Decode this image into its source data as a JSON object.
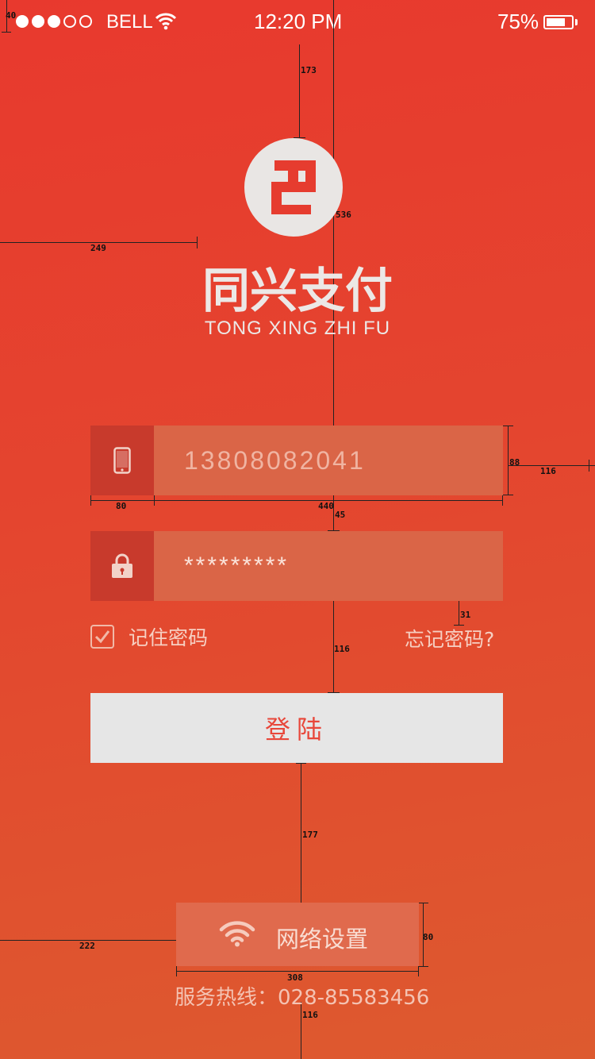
{
  "status_bar": {
    "signal_dots_filled": 3,
    "signal_dots_total": 5,
    "carrier": "BELL",
    "time": "12:20 PM",
    "battery_percent": "75%",
    "battery_level": 0.75
  },
  "brand": {
    "name_cn": "同兴支付",
    "name_en": "TONG XING ZHI FU"
  },
  "login_form": {
    "phone_value": "13808082041",
    "password_value": "*********",
    "remember_label": "记住密码",
    "remember_checked": true,
    "forgot_label": "忘记密码?",
    "login_label": "登陆"
  },
  "network_button": {
    "label": "网络设置"
  },
  "hotline": "服务热线：028-85583456",
  "annotations": {
    "top_gap": "40",
    "logo_top": "173",
    "logo_left": "249",
    "field_top": "536",
    "field_height": "88",
    "icon_height": "42",
    "text_gap": "31",
    "right_gap": "116",
    "icon_width": "80",
    "field_width": "440",
    "field_spacing": "45",
    "checkbox_gap": "31",
    "button_gap": "116",
    "bottom_gap": "177",
    "net_icon_top": "23",
    "net_height": "80",
    "net_left": "222",
    "net_icon_left": "54",
    "net_width": "308",
    "bottom_margin": "116"
  },
  "colors": {
    "background_top": "#e8392e",
    "background_bottom": "#dd5a2f",
    "field_bg": "#da6547",
    "icon_bg": "#c83a2c",
    "button_bg": "#e6e6e6",
    "button_text": "#e8473a"
  }
}
